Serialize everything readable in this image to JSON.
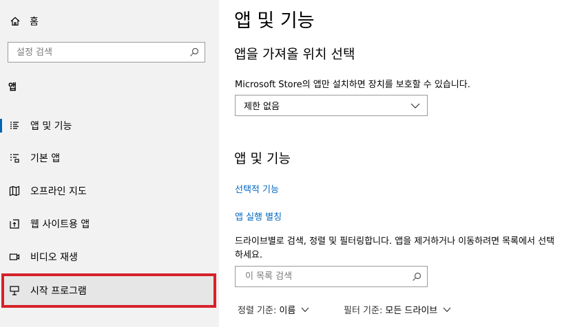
{
  "sidebar": {
    "home_label": "홈",
    "search_placeholder": "설정 검색",
    "section": "앱",
    "items": [
      {
        "label": "앱 및 기능"
      },
      {
        "label": "기본 앱"
      },
      {
        "label": "오프라인 지도"
      },
      {
        "label": "웹 사이트용 앱"
      },
      {
        "label": "비디오 재생"
      },
      {
        "label": "시작 프로그램"
      }
    ],
    "highlight_color": "#d6222a",
    "accent_color": "#0063b1"
  },
  "main": {
    "title": "앱 및 기능",
    "install_section": {
      "title": "앱을 가져올 위치 선택",
      "description": "Microsoft Store의 앱만 설치하면 장치를 보호할 수 있습니다.",
      "dropdown_value": "제한 없음"
    },
    "apps_section": {
      "title": "앱 및 기능",
      "links": [
        "선택적 기능",
        "앱 실행 별칭"
      ],
      "description": "드라이브별로 검색, 정렬 및 필터링합니다. 앱을 제거하거나 이동하려면 목록에서 선택하세요.",
      "search_placeholder": "이 목록 검색",
      "sort_label": "정렬 기준:",
      "sort_value": "이름",
      "filter_label": "필터 기준:",
      "filter_value": "모든 드라이브"
    },
    "link_color": "#0067c0"
  }
}
